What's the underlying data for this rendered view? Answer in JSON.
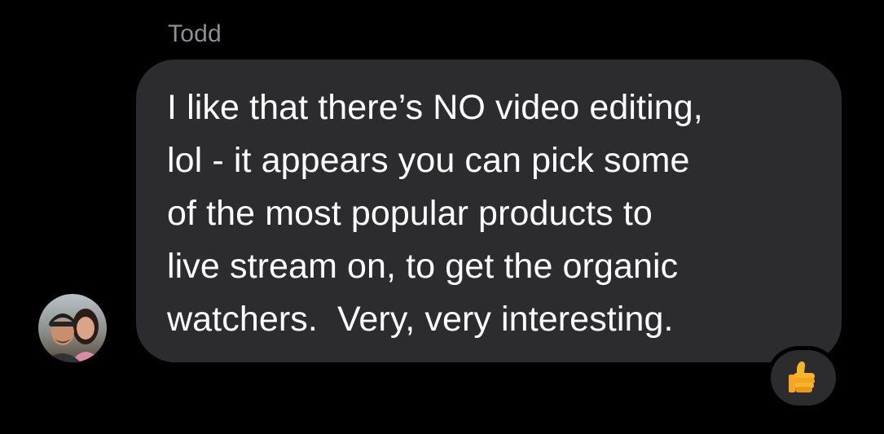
{
  "sender_name": "Todd",
  "message": {
    "lines": [
      "I like that there’s NO video editing,",
      "lol - it appears you can pick some",
      "of the most popular products to",
      "live stream on, to get the organic",
      "watchers.  Very, very interesting."
    ]
  },
  "reaction": {
    "icon": "thumbs-up-icon"
  },
  "colors": {
    "background": "#000000",
    "bubble": "#2c2c2e",
    "text": "#ffffff",
    "sender": "#8e8e93",
    "reaction_emoji": "#f7b52b"
  }
}
